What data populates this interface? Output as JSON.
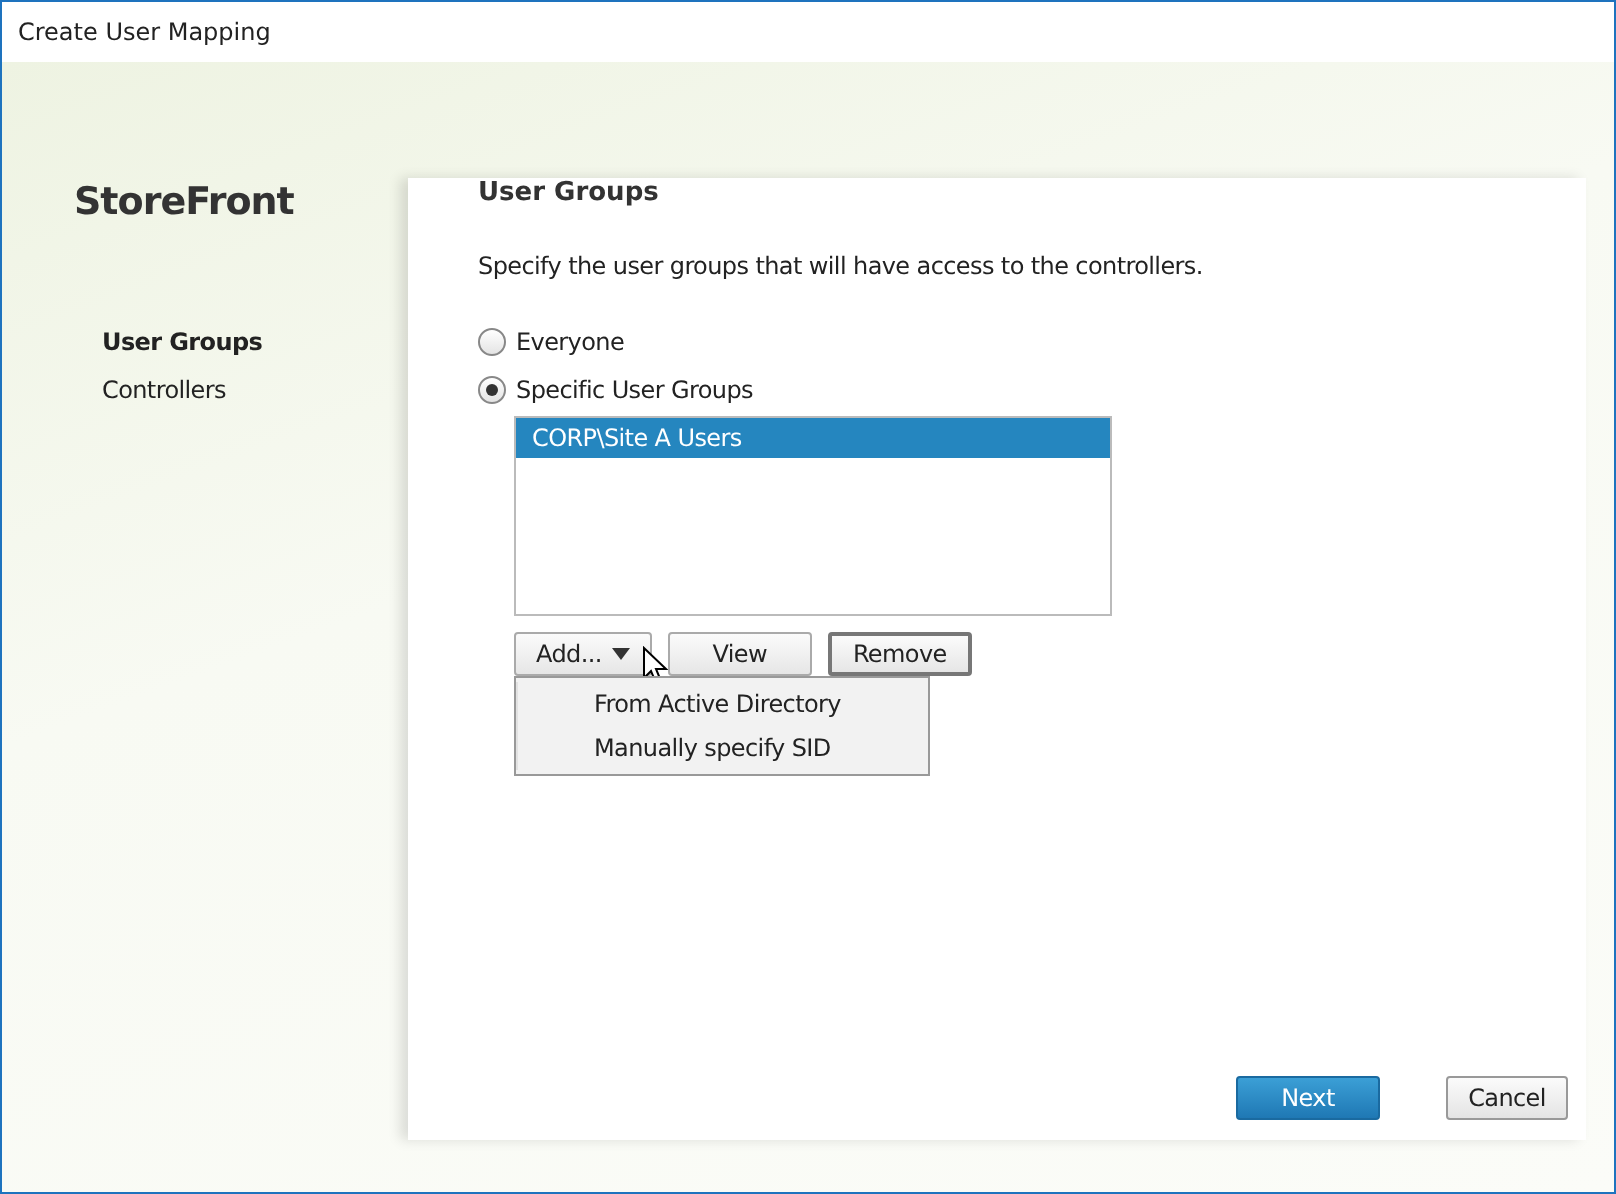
{
  "window": {
    "title": "Create User Mapping"
  },
  "sidebar": {
    "title": "StoreFront",
    "items": [
      {
        "label": "User Groups",
        "selected": true
      },
      {
        "label": "Controllers",
        "selected": false
      }
    ]
  },
  "page": {
    "heading": "User Groups",
    "description": "Specify the user groups that will have access to the controllers.",
    "options": [
      {
        "label": "Everyone",
        "selected": false
      },
      {
        "label": "Specific User Groups",
        "selected": true
      }
    ],
    "list": {
      "items": [
        {
          "label": "CORP\\Site A Users",
          "selected": true
        }
      ]
    },
    "buttons": [
      {
        "label": "Add...",
        "kind": "dropdown",
        "focused": false
      },
      {
        "label": "View",
        "kind": "plain",
        "focused": false
      },
      {
        "label": "Remove",
        "kind": "plain",
        "focused": true
      }
    ],
    "menu": {
      "items": [
        {
          "label": "From Active Directory"
        },
        {
          "label": "Manually specify SID"
        }
      ]
    }
  },
  "footer": {
    "buttons": [
      {
        "label": "Next",
        "kind": "primary"
      },
      {
        "label": "Cancel",
        "kind": "secondary"
      }
    ]
  }
}
